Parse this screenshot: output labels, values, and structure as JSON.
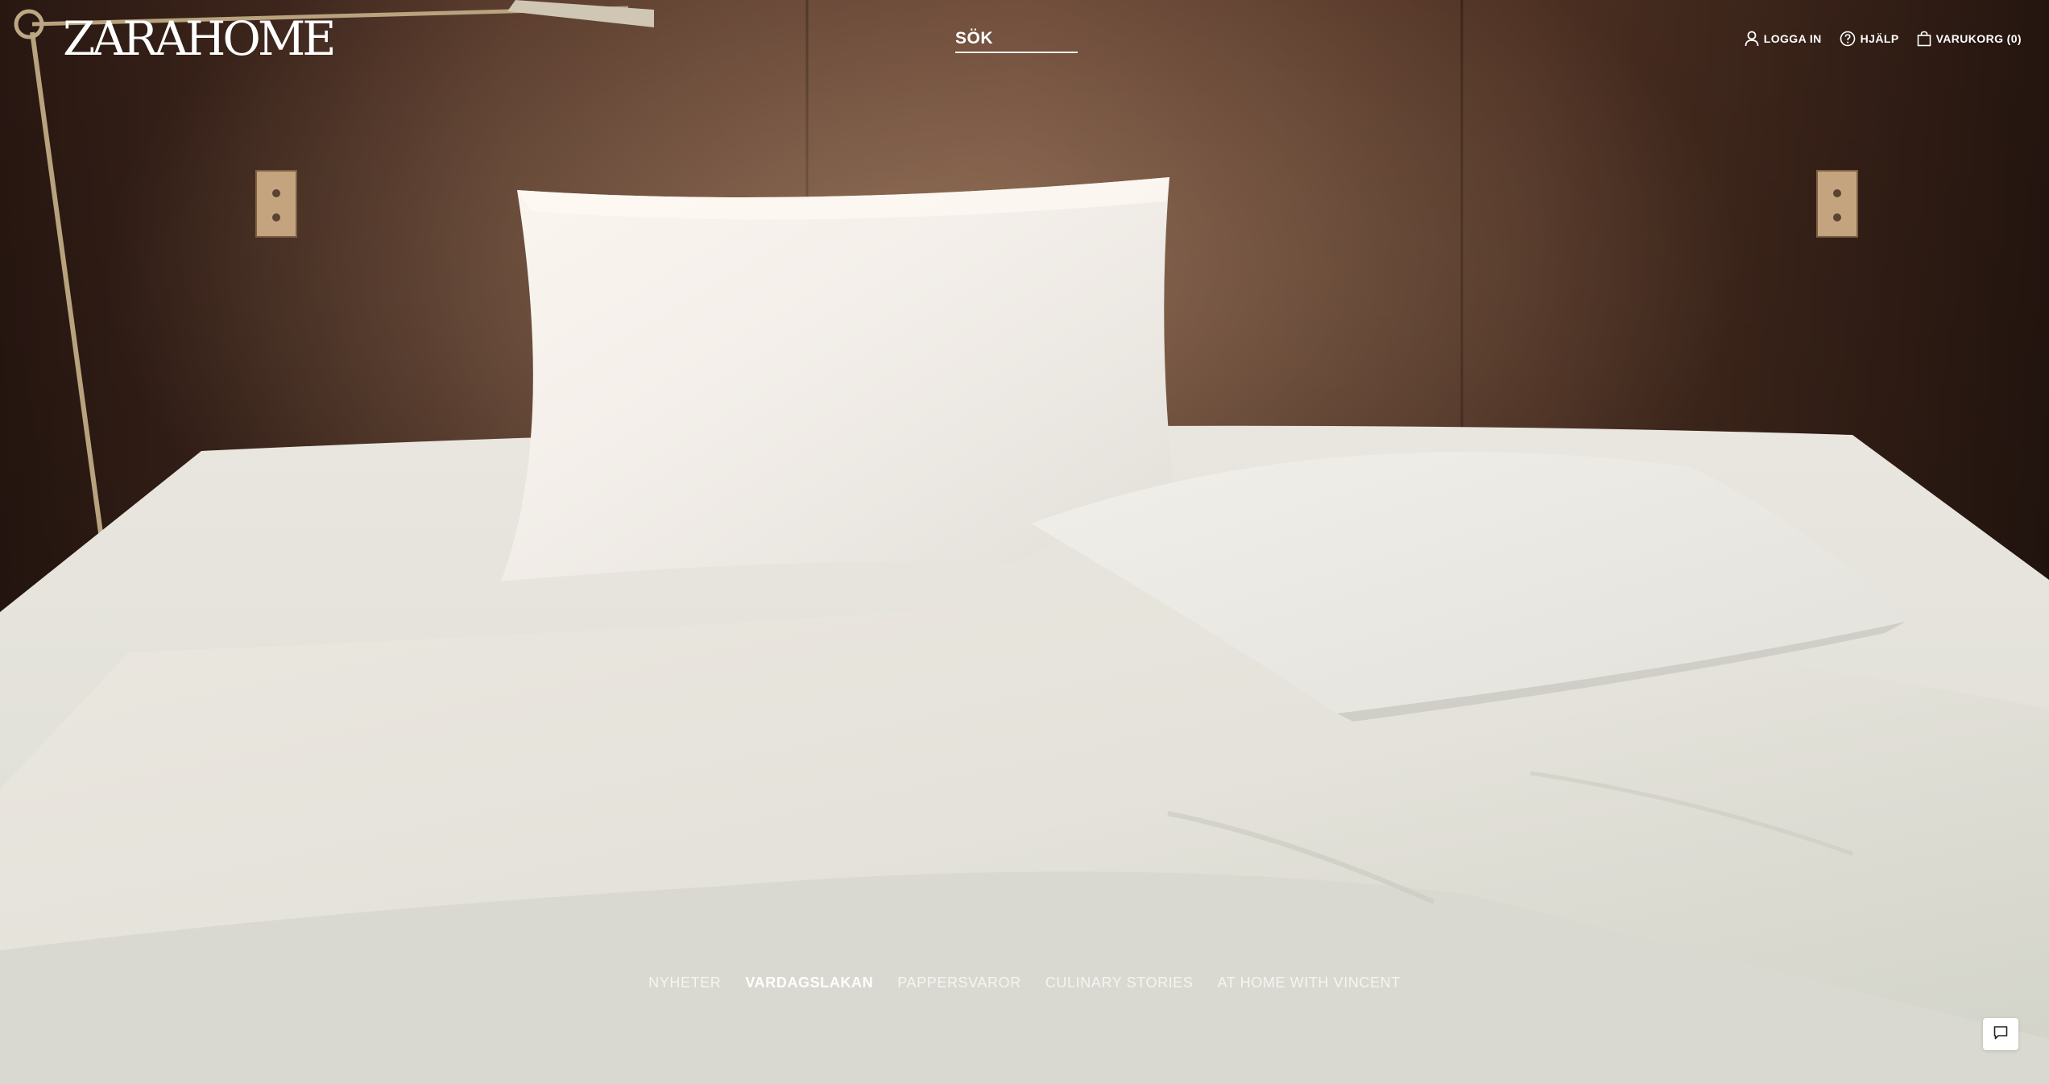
{
  "brand": {
    "logo_text": "ZARAHOME"
  },
  "search": {
    "label": "SÖK"
  },
  "topnav": {
    "login": "LOGGA IN",
    "help": "HJÄLP",
    "cart": "VARUKORG (0)"
  },
  "tabs": [
    {
      "label": "NYHETER",
      "active": false
    },
    {
      "label": "VARDAGSLAKAN",
      "active": true
    },
    {
      "label": "PAPPERSVAROR",
      "active": false
    },
    {
      "label": "CULINARY STORIES",
      "active": false
    },
    {
      "label": "AT HOME WITH VINCENT",
      "active": false
    }
  ],
  "colors": {
    "wood_dark": "#3d2419",
    "wood_mid": "#6b4331",
    "linen": "#ecebe6",
    "text_light": "#ffffff"
  },
  "icons": {
    "login": "user-icon",
    "help": "question-circle-icon",
    "cart": "shopping-bag-icon",
    "chat": "chat-bubble-icon"
  }
}
